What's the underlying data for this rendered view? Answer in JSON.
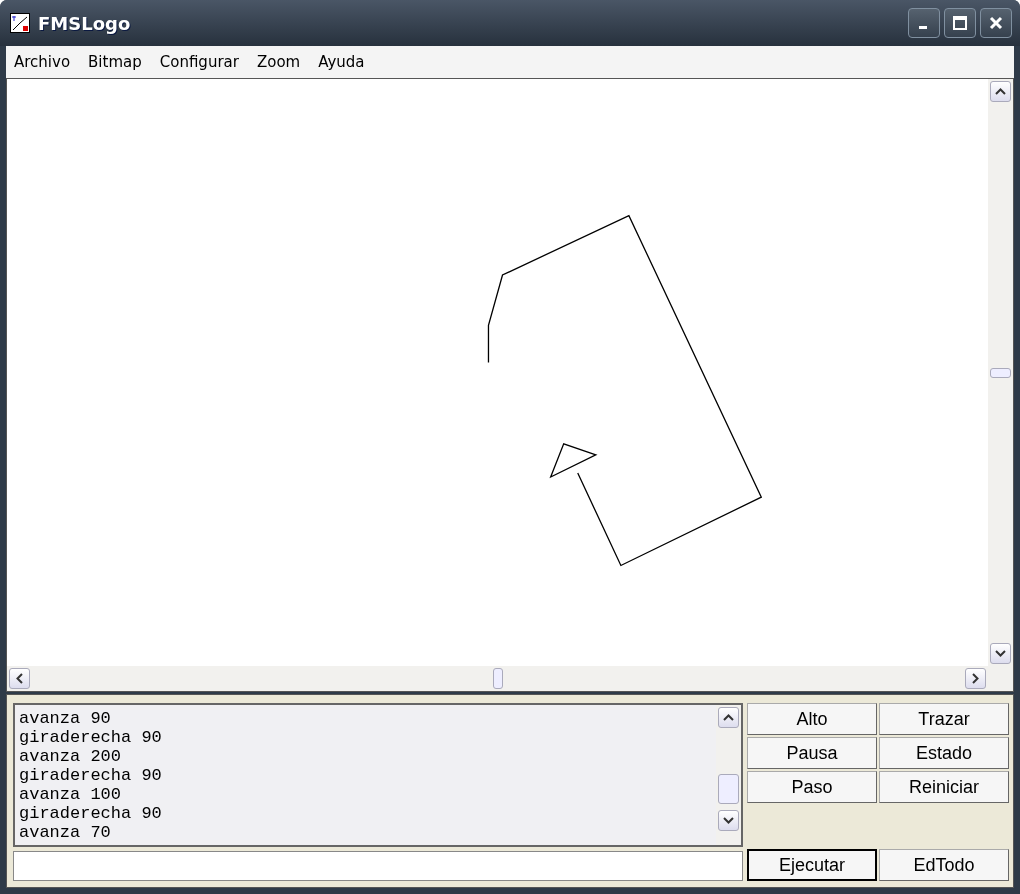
{
  "window": {
    "title": "FMSLogo"
  },
  "menu": [
    "Archivo",
    "Bitmap",
    "Configurar",
    "Zoom",
    "Ayuda"
  ],
  "history": [
    "avanza 90",
    "giraderecha 90",
    "avanza 200",
    "giraderecha 90",
    "avanza 100",
    "giraderecha 90",
    "avanza 70"
  ],
  "buttons": [
    {
      "label": "Alto",
      "default": false
    },
    {
      "label": "Trazar",
      "default": false
    },
    {
      "label": "Pausa",
      "default": false
    },
    {
      "label": "Estado",
      "default": false
    },
    {
      "label": "Paso",
      "default": false
    },
    {
      "label": "Reiniciar",
      "default": false
    }
  ],
  "run_buttons": [
    {
      "label": "Ejecutar",
      "default": true
    },
    {
      "label": "EdTodo",
      "default": false
    }
  ]
}
